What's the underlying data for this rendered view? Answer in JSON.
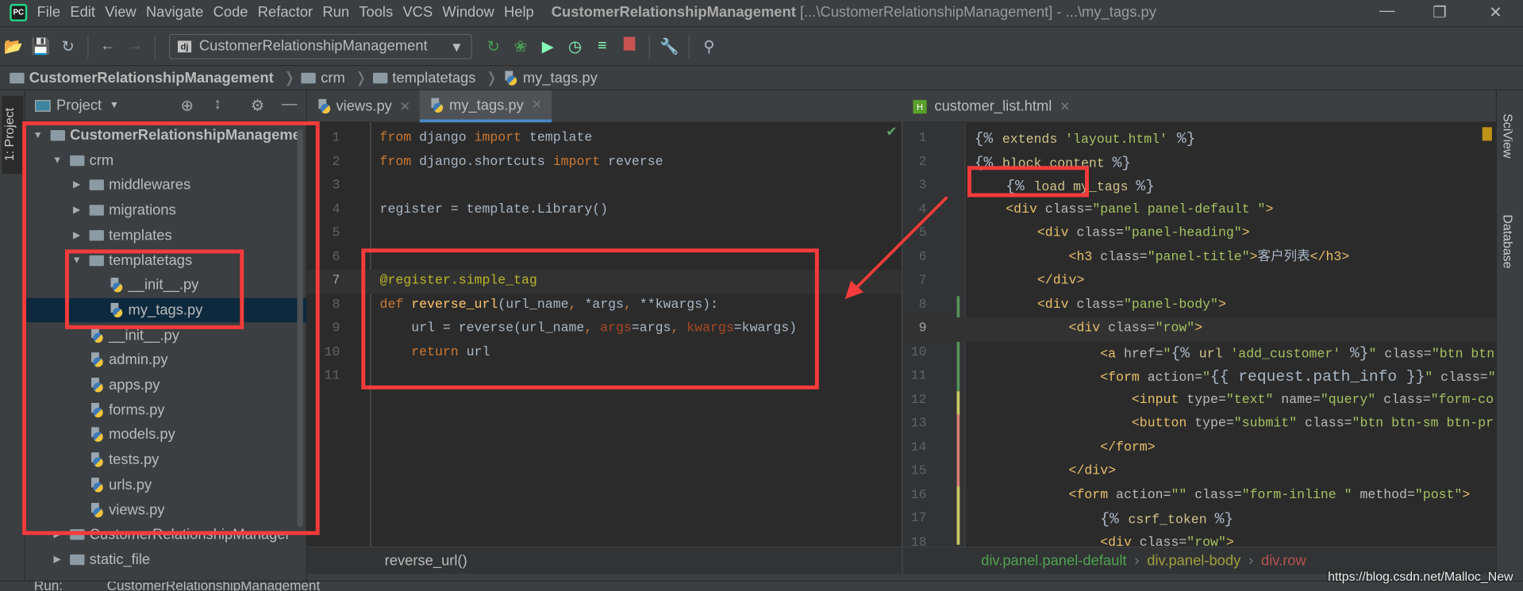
{
  "menu": [
    "File",
    "Edit",
    "View",
    "Navigate",
    "Code",
    "Refactor",
    "Run",
    "Tools",
    "VCS",
    "Window",
    "Help"
  ],
  "window_title": {
    "project": "CustomerRelationshipManagement",
    "rest": "[...\\CustomerRelationshipManagement] - ...\\my_tags.py"
  },
  "logo_text": "PC",
  "toolbar": {
    "run_config": "CustomerRelationshipManagement",
    "run_config_badge": "dj",
    "icons": [
      "open-icon",
      "save-icon",
      "sync-icon",
      "back-icon",
      "forward-icon",
      "rerun-icon",
      "debug-icon",
      "coverage-icon",
      "profile-icon",
      "concurrency-icon",
      "stop-icon",
      "settings-wrench-icon",
      "search-icon"
    ]
  },
  "breadcrumb": [
    "CustomerRelationshipManagement",
    "crm",
    "templatetags",
    "my_tags.py"
  ],
  "project_panel": {
    "title": "Project",
    "side_tab": "1: Project",
    "tree": [
      {
        "label": "CustomerRelationshipManageme",
        "depth": 0,
        "arrow": "down",
        "type": "folder",
        "bold": true
      },
      {
        "label": "crm",
        "depth": 1,
        "arrow": "down",
        "type": "pkg"
      },
      {
        "label": "middlewares",
        "depth": 2,
        "arrow": "right",
        "type": "pkg"
      },
      {
        "label": "migrations",
        "depth": 2,
        "arrow": "right",
        "type": "pkg"
      },
      {
        "label": "templates",
        "depth": 2,
        "arrow": "right",
        "type": "pkg"
      },
      {
        "label": "templatetags",
        "depth": 2,
        "arrow": "down",
        "type": "pkg"
      },
      {
        "label": "__init__.py",
        "depth": 3,
        "type": "py"
      },
      {
        "label": "my_tags.py",
        "depth": 3,
        "type": "py",
        "selected": true
      },
      {
        "label": "__init__.py",
        "depth": 2,
        "type": "py"
      },
      {
        "label": "admin.py",
        "depth": 2,
        "type": "py"
      },
      {
        "label": "apps.py",
        "depth": 2,
        "type": "py"
      },
      {
        "label": "forms.py",
        "depth": 2,
        "type": "py"
      },
      {
        "label": "models.py",
        "depth": 2,
        "type": "py"
      },
      {
        "label": "tests.py",
        "depth": 2,
        "type": "py"
      },
      {
        "label": "urls.py",
        "depth": 2,
        "type": "py"
      },
      {
        "label": "views.py",
        "depth": 2,
        "type": "py"
      },
      {
        "label": "CustomerRelationshipManager",
        "depth": 1,
        "arrow": "right",
        "type": "pkg"
      },
      {
        "label": "static_file",
        "depth": 1,
        "arrow": "right",
        "type": "pkg"
      }
    ]
  },
  "editor_left": {
    "tabs": [
      {
        "label": "views.py",
        "active": false
      },
      {
        "label": "my_tags.py",
        "active": true
      }
    ],
    "current_line": 7,
    "lines": [
      [
        [
          "from ",
          "k"
        ],
        [
          "django ",
          "n"
        ],
        [
          "import ",
          "k"
        ],
        [
          "template",
          "n"
        ]
      ],
      [
        [
          "from ",
          "k"
        ],
        [
          "django.shortcuts ",
          "n"
        ],
        [
          "import ",
          "k"
        ],
        [
          "reverse",
          "n"
        ]
      ],
      [],
      [
        [
          "register = template.Library()",
          "n"
        ]
      ],
      [],
      [],
      [
        [
          "@register.",
          "dec"
        ],
        [
          "simple_tag",
          "dec"
        ]
      ],
      [
        [
          "def ",
          "k"
        ],
        [
          "reverse_url",
          "f"
        ],
        [
          "(url_name",
          "n"
        ],
        [
          ", ",
          "k"
        ],
        [
          "*args",
          "n"
        ],
        [
          ", ",
          "k"
        ],
        [
          "**kwargs):",
          "n"
        ]
      ],
      [
        [
          "    url = reverse(url_name",
          "n"
        ],
        [
          ", ",
          "k"
        ],
        [
          "args",
          "p"
        ],
        [
          "=args",
          "n"
        ],
        [
          ", ",
          "k"
        ],
        [
          "kwargs",
          "p"
        ],
        [
          "=kwargs)",
          "n"
        ]
      ],
      [
        [
          "    ",
          "n"
        ],
        [
          "return ",
          "k"
        ],
        [
          "url",
          "n"
        ]
      ],
      []
    ],
    "status_crumb": "reverse_url()"
  },
  "editor_right": {
    "tabs": [
      {
        "label": "customer_list.html",
        "active": false
      }
    ],
    "current_line": 9,
    "lines": [
      [
        [
          "{% ",
          "tb"
        ],
        [
          "extends ",
          "tk"
        ],
        [
          "'layout.html'",
          "st"
        ],
        [
          " %}",
          "tb"
        ]
      ],
      [
        [
          "{% ",
          "tb"
        ],
        [
          "block content ",
          "tk"
        ],
        [
          "%}",
          "tb"
        ]
      ],
      [
        [
          "    ",
          "n"
        ],
        [
          "{% ",
          "tb"
        ],
        [
          "load my_tags ",
          "tk"
        ],
        [
          "%}",
          "tb"
        ]
      ],
      [
        [
          "    ",
          "n"
        ],
        [
          "<div",
          "tg"
        ],
        [
          " class=",
          "at"
        ],
        [
          "\"panel panel-default \"",
          "st"
        ],
        [
          ">",
          "tg"
        ]
      ],
      [
        [
          "        ",
          "n"
        ],
        [
          "<div",
          "tg"
        ],
        [
          " class=",
          "at"
        ],
        [
          "\"panel-heading\"",
          "st"
        ],
        [
          ">",
          "tg"
        ]
      ],
      [
        [
          "            ",
          "n"
        ],
        [
          "<h3",
          "tg"
        ],
        [
          " class=",
          "at"
        ],
        [
          "\"panel-title\"",
          "st"
        ],
        [
          ">",
          "tg"
        ],
        [
          "客户列表",
          "n"
        ],
        [
          "</h3>",
          "tg"
        ]
      ],
      [
        [
          "        ",
          "n"
        ],
        [
          "</div>",
          "tg"
        ]
      ],
      [
        [
          "        ",
          "n"
        ],
        [
          "<div",
          "tg"
        ],
        [
          " class=",
          "at"
        ],
        [
          "\"panel-body\"",
          "st"
        ],
        [
          ">",
          "tg"
        ]
      ],
      [
        [
          "            ",
          "n"
        ],
        [
          "<div",
          "tg"
        ],
        [
          " class=",
          "at"
        ],
        [
          "\"row\"",
          "st"
        ],
        [
          ">",
          "tg"
        ]
      ],
      [
        [
          "                ",
          "n"
        ],
        [
          "<a",
          "tg"
        ],
        [
          " href=",
          "at"
        ],
        [
          "\"",
          "st"
        ],
        [
          "{% ",
          "tb"
        ],
        [
          "url ",
          "tk"
        ],
        [
          "'add_customer'",
          "st"
        ],
        [
          " %}",
          "tb"
        ],
        [
          "\"",
          "st"
        ],
        [
          " class=",
          "at"
        ],
        [
          "\"btn btn-",
          "st"
        ]
      ],
      [
        [
          "                ",
          "n"
        ],
        [
          "<form",
          "tg"
        ],
        [
          " action=",
          "at"
        ],
        [
          "\"",
          "st"
        ],
        [
          "{{ request.path_info }}",
          "tb"
        ],
        [
          "\"",
          "st"
        ],
        [
          " class=",
          "at"
        ],
        [
          "\"form",
          "st"
        ]
      ],
      [
        [
          "                    ",
          "n"
        ],
        [
          "<input",
          "tg"
        ],
        [
          " type=",
          "at"
        ],
        [
          "\"text\"",
          "st"
        ],
        [
          " name=",
          "at"
        ],
        [
          "\"query\"",
          "st"
        ],
        [
          " class=",
          "at"
        ],
        [
          "\"form-co",
          "st"
        ]
      ],
      [
        [
          "                    ",
          "n"
        ],
        [
          "<button",
          "tg"
        ],
        [
          " type=",
          "at"
        ],
        [
          "\"submit\"",
          "st"
        ],
        [
          " class=",
          "at"
        ],
        [
          "\"btn btn-sm btn-pr",
          "st"
        ]
      ],
      [
        [
          "                ",
          "n"
        ],
        [
          "</form>",
          "tg"
        ]
      ],
      [
        [
          "            ",
          "n"
        ],
        [
          "</div>",
          "tg"
        ]
      ],
      [
        [
          "            ",
          "n"
        ],
        [
          "<form",
          "tg"
        ],
        [
          " action=",
          "at"
        ],
        [
          "\"\"",
          "st"
        ],
        [
          " class=",
          "at"
        ],
        [
          "\"form-inline \"",
          "st"
        ],
        [
          " method=",
          "at"
        ],
        [
          "\"post\"",
          "st"
        ],
        [
          ">",
          "tg"
        ]
      ],
      [
        [
          "                ",
          "n"
        ],
        [
          "{% ",
          "tb"
        ],
        [
          "csrf_token ",
          "tk"
        ],
        [
          "%}",
          "tb"
        ]
      ],
      [
        [
          "                ",
          "n"
        ],
        [
          "<div",
          "tg"
        ],
        [
          " class=",
          "at"
        ],
        [
          "\"row\"",
          "st"
        ],
        [
          ">",
          "tg"
        ]
      ]
    ],
    "status_crumbs": [
      {
        "label": "div.panel.panel-default",
        "color": "#4fa34f"
      },
      {
        "label": "div.panel-body",
        "color": "#a0a03c"
      },
      {
        "label": "div.row",
        "color": "#b5524f"
      }
    ]
  },
  "right_strip": [
    "SciView",
    "Database"
  ],
  "run_bar": {
    "label": "Run:",
    "config": "CustomerRelationshipManagement"
  },
  "watermark": "https://blog.csdn.net/Malloc_New",
  "colors": {
    "annotation": "#f53b3b",
    "editor_bg": "#2b2b2b",
    "panel_bg": "#3c3f41",
    "selection": "#0d293e",
    "tab_underline": "#4a88c7"
  }
}
